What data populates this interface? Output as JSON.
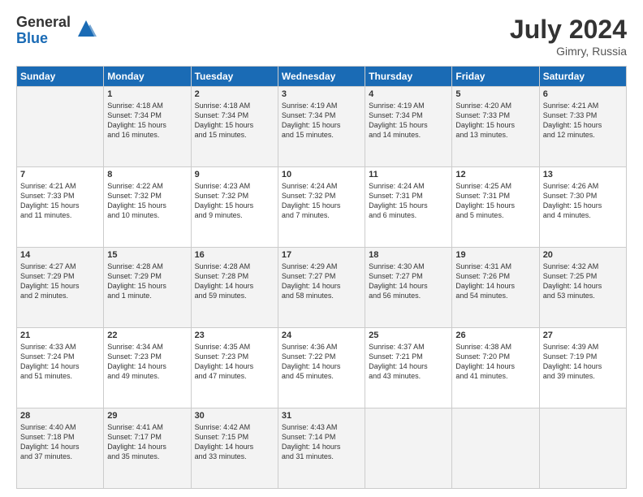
{
  "logo": {
    "general": "General",
    "blue": "Blue"
  },
  "title": {
    "month_year": "July 2024",
    "location": "Gimry, Russia"
  },
  "headers": [
    "Sunday",
    "Monday",
    "Tuesday",
    "Wednesday",
    "Thursday",
    "Friday",
    "Saturday"
  ],
  "weeks": [
    [
      {
        "num": "",
        "content": ""
      },
      {
        "num": "1",
        "content": "Sunrise: 4:18 AM\nSunset: 7:34 PM\nDaylight: 15 hours\nand 16 minutes."
      },
      {
        "num": "2",
        "content": "Sunrise: 4:18 AM\nSunset: 7:34 PM\nDaylight: 15 hours\nand 15 minutes."
      },
      {
        "num": "3",
        "content": "Sunrise: 4:19 AM\nSunset: 7:34 PM\nDaylight: 15 hours\nand 15 minutes."
      },
      {
        "num": "4",
        "content": "Sunrise: 4:19 AM\nSunset: 7:34 PM\nDaylight: 15 hours\nand 14 minutes."
      },
      {
        "num": "5",
        "content": "Sunrise: 4:20 AM\nSunset: 7:33 PM\nDaylight: 15 hours\nand 13 minutes."
      },
      {
        "num": "6",
        "content": "Sunrise: 4:21 AM\nSunset: 7:33 PM\nDaylight: 15 hours\nand 12 minutes."
      }
    ],
    [
      {
        "num": "7",
        "content": "Sunrise: 4:21 AM\nSunset: 7:33 PM\nDaylight: 15 hours\nand 11 minutes."
      },
      {
        "num": "8",
        "content": "Sunrise: 4:22 AM\nSunset: 7:32 PM\nDaylight: 15 hours\nand 10 minutes."
      },
      {
        "num": "9",
        "content": "Sunrise: 4:23 AM\nSunset: 7:32 PM\nDaylight: 15 hours\nand 9 minutes."
      },
      {
        "num": "10",
        "content": "Sunrise: 4:24 AM\nSunset: 7:32 PM\nDaylight: 15 hours\nand 7 minutes."
      },
      {
        "num": "11",
        "content": "Sunrise: 4:24 AM\nSunset: 7:31 PM\nDaylight: 15 hours\nand 6 minutes."
      },
      {
        "num": "12",
        "content": "Sunrise: 4:25 AM\nSunset: 7:31 PM\nDaylight: 15 hours\nand 5 minutes."
      },
      {
        "num": "13",
        "content": "Sunrise: 4:26 AM\nSunset: 7:30 PM\nDaylight: 15 hours\nand 4 minutes."
      }
    ],
    [
      {
        "num": "14",
        "content": "Sunrise: 4:27 AM\nSunset: 7:29 PM\nDaylight: 15 hours\nand 2 minutes."
      },
      {
        "num": "15",
        "content": "Sunrise: 4:28 AM\nSunset: 7:29 PM\nDaylight: 15 hours\nand 1 minute."
      },
      {
        "num": "16",
        "content": "Sunrise: 4:28 AM\nSunset: 7:28 PM\nDaylight: 14 hours\nand 59 minutes."
      },
      {
        "num": "17",
        "content": "Sunrise: 4:29 AM\nSunset: 7:27 PM\nDaylight: 14 hours\nand 58 minutes."
      },
      {
        "num": "18",
        "content": "Sunrise: 4:30 AM\nSunset: 7:27 PM\nDaylight: 14 hours\nand 56 minutes."
      },
      {
        "num": "19",
        "content": "Sunrise: 4:31 AM\nSunset: 7:26 PM\nDaylight: 14 hours\nand 54 minutes."
      },
      {
        "num": "20",
        "content": "Sunrise: 4:32 AM\nSunset: 7:25 PM\nDaylight: 14 hours\nand 53 minutes."
      }
    ],
    [
      {
        "num": "21",
        "content": "Sunrise: 4:33 AM\nSunset: 7:24 PM\nDaylight: 14 hours\nand 51 minutes."
      },
      {
        "num": "22",
        "content": "Sunrise: 4:34 AM\nSunset: 7:23 PM\nDaylight: 14 hours\nand 49 minutes."
      },
      {
        "num": "23",
        "content": "Sunrise: 4:35 AM\nSunset: 7:23 PM\nDaylight: 14 hours\nand 47 minutes."
      },
      {
        "num": "24",
        "content": "Sunrise: 4:36 AM\nSunset: 7:22 PM\nDaylight: 14 hours\nand 45 minutes."
      },
      {
        "num": "25",
        "content": "Sunrise: 4:37 AM\nSunset: 7:21 PM\nDaylight: 14 hours\nand 43 minutes."
      },
      {
        "num": "26",
        "content": "Sunrise: 4:38 AM\nSunset: 7:20 PM\nDaylight: 14 hours\nand 41 minutes."
      },
      {
        "num": "27",
        "content": "Sunrise: 4:39 AM\nSunset: 7:19 PM\nDaylight: 14 hours\nand 39 minutes."
      }
    ],
    [
      {
        "num": "28",
        "content": "Sunrise: 4:40 AM\nSunset: 7:18 PM\nDaylight: 14 hours\nand 37 minutes."
      },
      {
        "num": "29",
        "content": "Sunrise: 4:41 AM\nSunset: 7:17 PM\nDaylight: 14 hours\nand 35 minutes."
      },
      {
        "num": "30",
        "content": "Sunrise: 4:42 AM\nSunset: 7:15 PM\nDaylight: 14 hours\nand 33 minutes."
      },
      {
        "num": "31",
        "content": "Sunrise: 4:43 AM\nSunset: 7:14 PM\nDaylight: 14 hours\nand 31 minutes."
      },
      {
        "num": "",
        "content": ""
      },
      {
        "num": "",
        "content": ""
      },
      {
        "num": "",
        "content": ""
      }
    ]
  ]
}
